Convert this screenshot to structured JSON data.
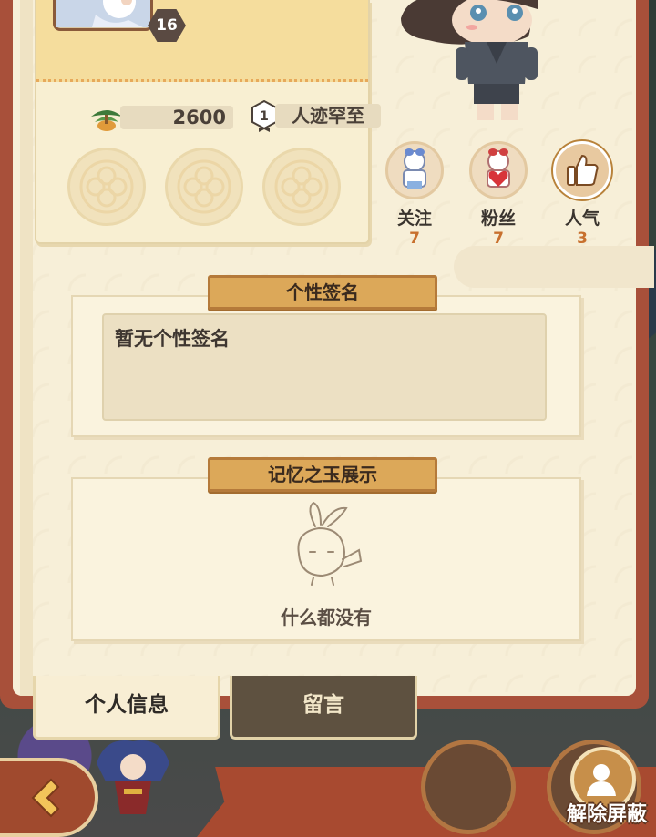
{
  "profile": {
    "level": "16",
    "coins": "2600",
    "title_rank": "1",
    "title": "人迹罕至",
    "slots": [
      "empty",
      "empty",
      "empty"
    ]
  },
  "social": {
    "follow": {
      "label": "关注",
      "count": "7",
      "icon": "follow-doll-icon"
    },
    "fans": {
      "label": "粉丝",
      "count": "7",
      "icon": "fans-heart-doll-icon"
    },
    "popularity": {
      "label": "人气",
      "count": "3",
      "icon": "thumbs-up-icon"
    }
  },
  "signature": {
    "title": "个性签名",
    "text": "暂无个性签名"
  },
  "memory": {
    "title": "记忆之玉展示",
    "empty_text": "什么都没有"
  },
  "tabs": {
    "info": "个人信息",
    "messages": "留言"
  },
  "bottom": {
    "unblock_label": "解除屏蔽"
  },
  "colors": {
    "frame": "#a8503a",
    "paper": "#f7efd8",
    "title_ribbon": "#dca859",
    "count_orange": "#c8702e"
  }
}
